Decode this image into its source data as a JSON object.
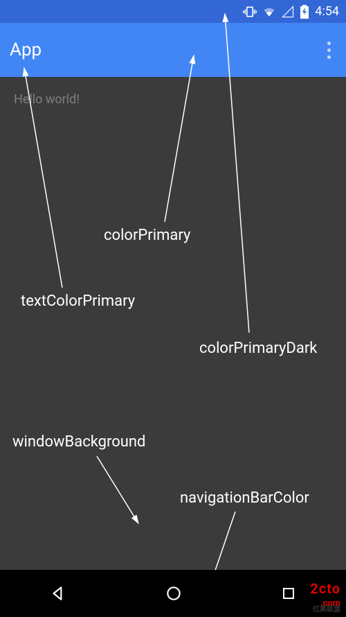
{
  "status_bar": {
    "time": "4:54",
    "icons": {
      "vibrate": "vibrate-icon",
      "wifi": "wifi-icon",
      "cell": "cell-signal-icon",
      "battery": "battery-charging-icon"
    }
  },
  "app_bar": {
    "title": "App",
    "overflow": "overflow-menu"
  },
  "content": {
    "hello_text": "Hello world!"
  },
  "annotations": {
    "colorPrimary": "colorPrimary",
    "textColorPrimary": "textColorPrimary",
    "colorPrimaryDark": "colorPrimaryDark",
    "windowBackground": "windowBackground",
    "navigationBarColor": "navigationBarColor"
  },
  "colors": {
    "colorPrimary": "#4285f4",
    "colorPrimaryDark": "#3367d6",
    "windowBackground": "#3b3b3b",
    "navigationBarColor": "#000000",
    "textColorPrimary": "#ffffff"
  },
  "nav_bar": {
    "back": "back-button",
    "home": "home-button",
    "recents": "recents-button"
  },
  "watermark": {
    "line1": "2cto",
    "line2": ".com",
    "sub": "红黑联盟"
  }
}
